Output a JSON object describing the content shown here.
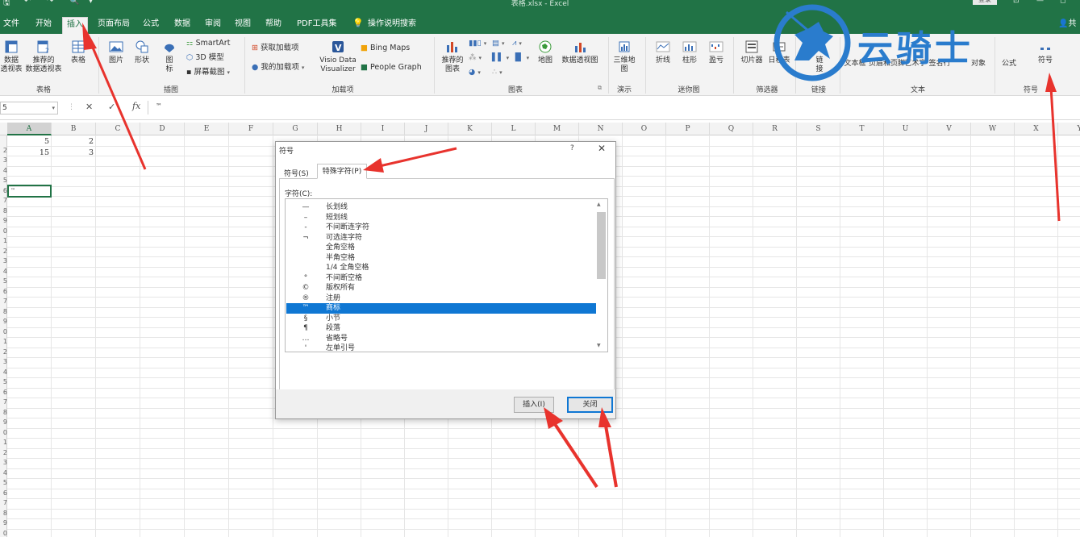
{
  "window": {
    "title": "表格.xlsx  -  Excel",
    "account_label": "登录",
    "qat_save": "🖫",
    "qat_undo": "↶",
    "qat_redo": "↷",
    "qat_preview": "🔍",
    "qat_more": "▾",
    "win_icons": [
      "⊡",
      "—",
      "◻"
    ]
  },
  "ribbon_tabs": [
    "文件",
    "开始",
    "插入",
    "页面布局",
    "公式",
    "数据",
    "审阅",
    "视图",
    "帮助",
    "PDF工具集",
    "操作说明搜索"
  ],
  "share_label": "共",
  "ribbon": {
    "table_group": {
      "pivot": "数据\n透视表",
      "recommended_pivot": "推荐的\n数据透视表",
      "table": "表格",
      "label": "表格"
    },
    "illustrations": {
      "picture": "图片",
      "shapes": "形状",
      "icons": "图\n标",
      "smartart": "SmartArt",
      "model3d": "3D 模型",
      "screenshot": "屏幕截图",
      "label": "插图"
    },
    "addins": {
      "get": "获取加载项",
      "my": "我的加载项",
      "visio": "Visio Data\nVisualizer",
      "bing": "Bing Maps",
      "people": "People Graph",
      "label": "加载项"
    },
    "charts": {
      "recommended": "推荐的\n图表",
      "map": "地图",
      "pivotchart": "数据透视图",
      "label": "图表"
    },
    "tours": {
      "map3d": "三维地\n图",
      "label": "演示"
    },
    "sparklines": {
      "line": "折线",
      "column": "柱形",
      "winloss": "盈亏",
      "label": "迷你图"
    },
    "filters": {
      "slicer": "切片器",
      "timeline": "日程表",
      "label": "筛选器"
    },
    "links": {
      "link": "链\n接",
      "label": "链接"
    },
    "text": {
      "textbox": "文本框",
      "headerfooter": "页眉和页脚",
      "wordart": "艺术字",
      "signature": "签名行",
      "object": "对象",
      "label": "文本"
    },
    "symbols": {
      "equation": "公式",
      "symbol": "符号",
      "label": "符号"
    }
  },
  "formula_bar": {
    "namebox": "5",
    "value": "™"
  },
  "columns": [
    "A",
    "B",
    "C",
    "D",
    "E",
    "F",
    "G",
    "H",
    "I",
    "J",
    "K",
    "L",
    "M",
    "N",
    "O",
    "P",
    "Q",
    "R",
    "S",
    "T",
    "U",
    "V",
    "W",
    "X",
    "Y"
  ],
  "row_numbers": [
    "",
    "2",
    "3",
    "4",
    "5",
    "6",
    "7",
    "8",
    "9",
    "0",
    "1",
    "2",
    "3",
    "4",
    "5",
    "6",
    "7",
    "8",
    "9",
    "0",
    "1",
    "2",
    "3",
    "4",
    "5",
    "6",
    "7",
    "8",
    "9",
    "0",
    "1",
    "2",
    "3",
    "4",
    "5",
    "6",
    "7",
    "8",
    "9",
    "0",
    "1"
  ],
  "cells": {
    "a1": "5",
    "b1": "2",
    "a2": "15",
    "b2": "3",
    "a6": "™"
  },
  "dialog": {
    "title": "符号",
    "help": "?",
    "close": "✕",
    "tab_symbols": "符号(S)",
    "tab_special": "特殊字符(P)",
    "chars_label": "字符(C):",
    "items": [
      {
        "sym": "—",
        "name": "长划线"
      },
      {
        "sym": "–",
        "name": "短划线"
      },
      {
        "sym": "‑",
        "name": "不间断连字符"
      },
      {
        "sym": "¬",
        "name": "可选连字符"
      },
      {
        "sym": "",
        "name": "全角空格"
      },
      {
        "sym": "",
        "name": "半角空格"
      },
      {
        "sym": "",
        "name": "1/4 全角空格"
      },
      {
        "sym": "°",
        "name": "不间断空格"
      },
      {
        "sym": "©",
        "name": "版权所有"
      },
      {
        "sym": "®",
        "name": "注册"
      },
      {
        "sym": "™",
        "name": "商标"
      },
      {
        "sym": "§",
        "name": "小节"
      },
      {
        "sym": "¶",
        "name": "段落"
      },
      {
        "sym": "…",
        "name": "省略号"
      },
      {
        "sym": "'",
        "name": "左单引号"
      }
    ],
    "selected_index": 10,
    "insert_btn": "插入(I)",
    "close_btn": "关闭"
  },
  "watermark": {
    "text": "云骑士"
  },
  "colors": {
    "excel_green": "#217346",
    "selection_blue": "#0f77d3",
    "arrow_red": "#e8332d",
    "watermark_blue": "#2a7ccd"
  }
}
